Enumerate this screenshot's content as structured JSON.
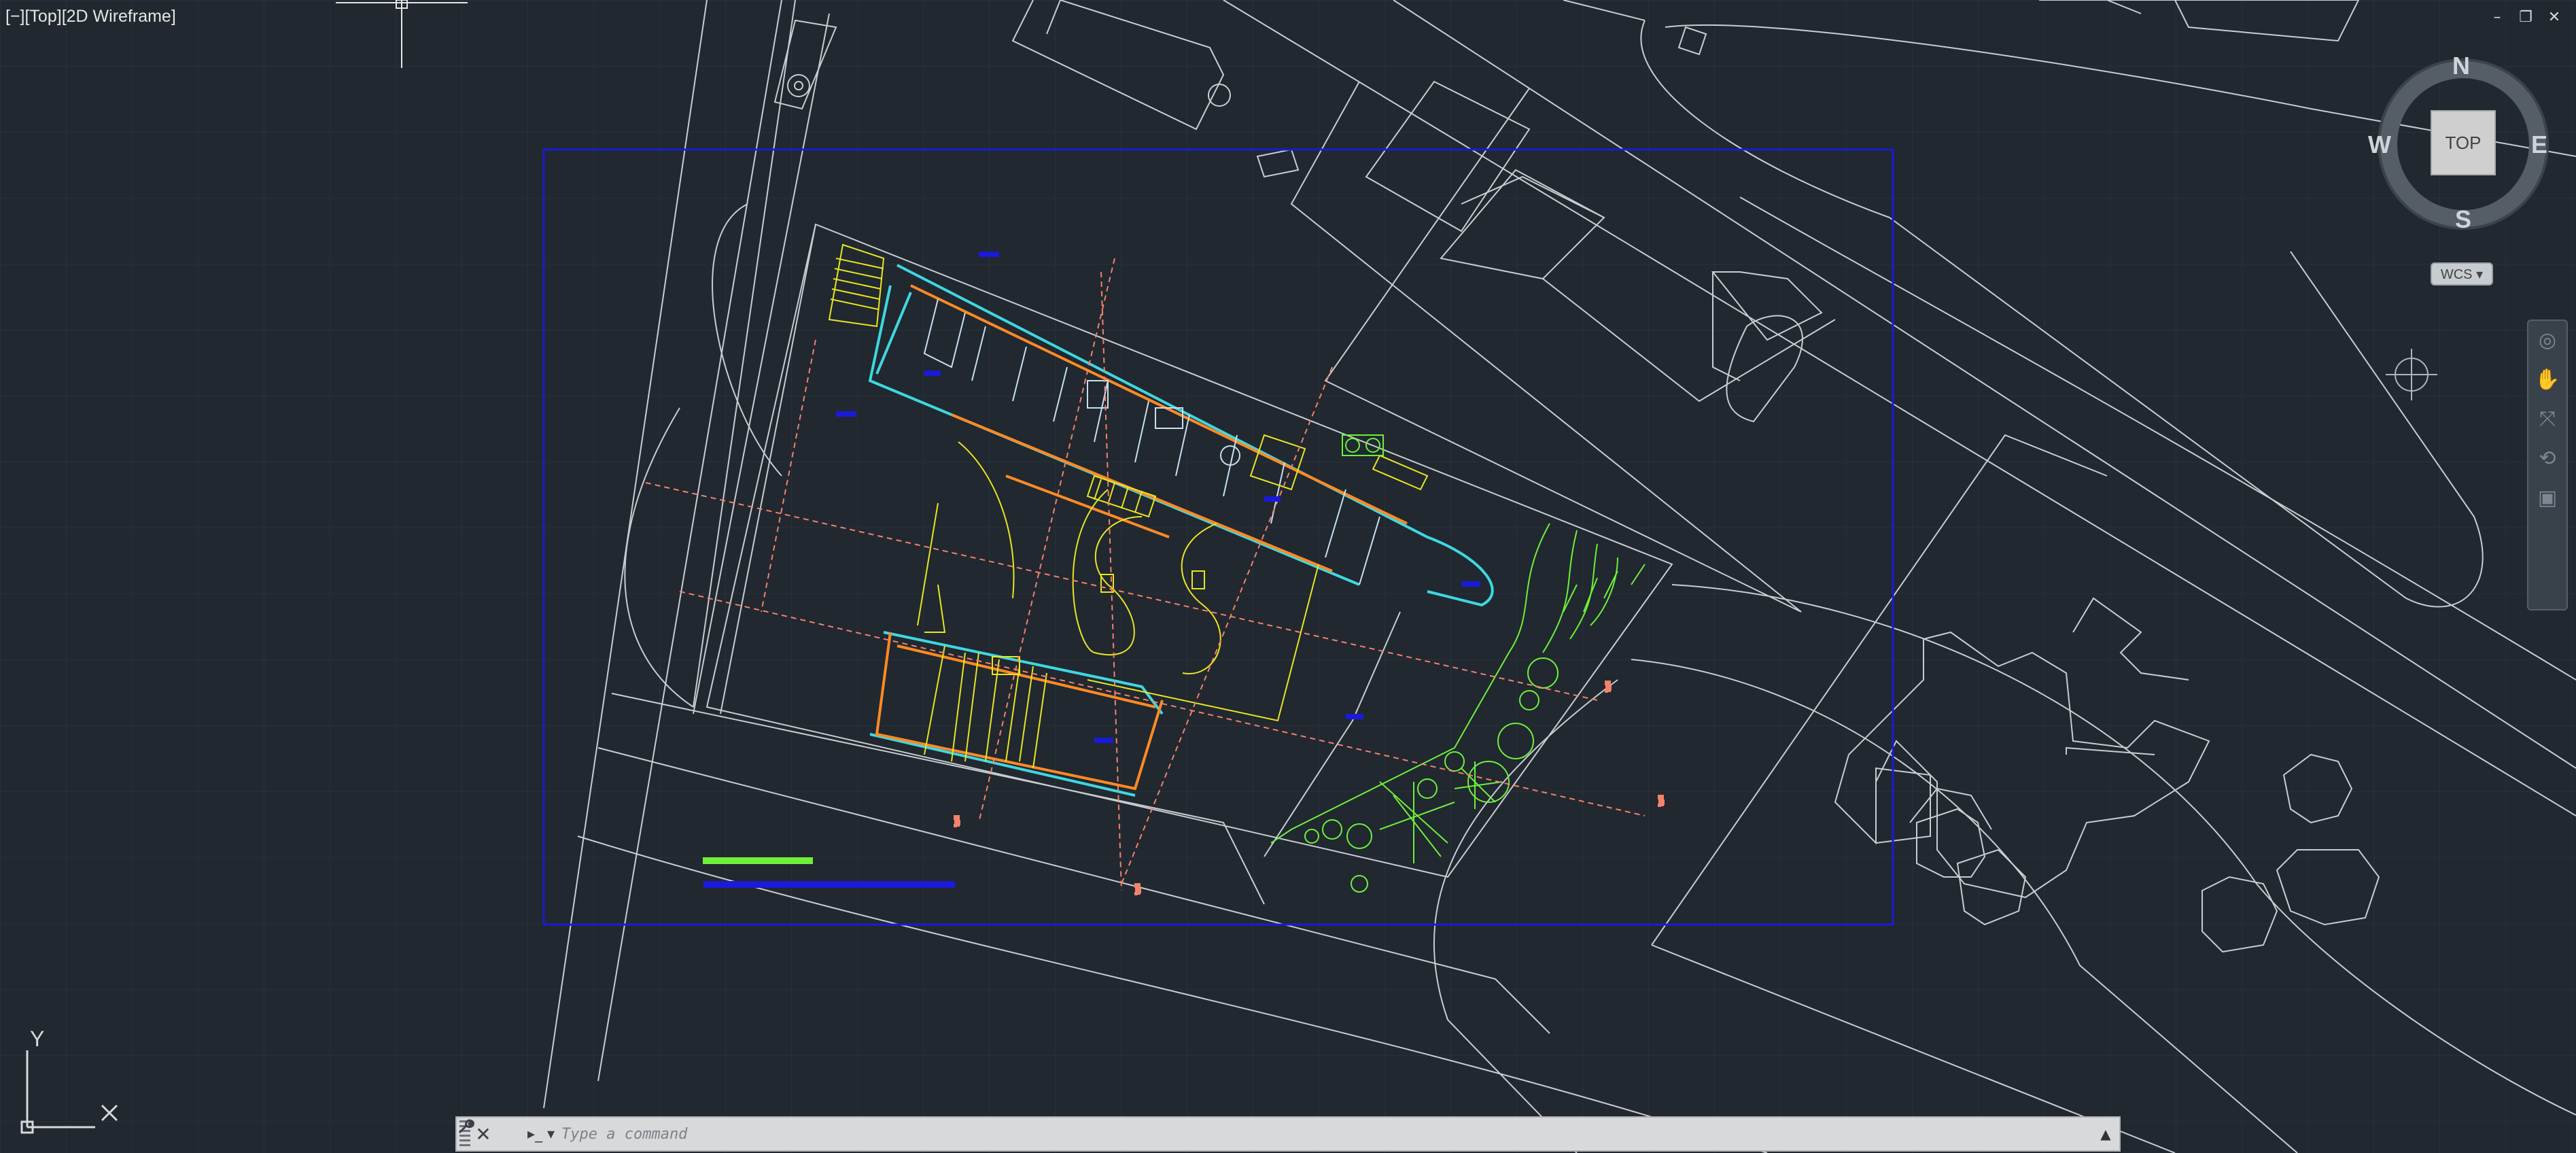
{
  "viewport": {
    "label": "[−][Top][2D Wireframe]"
  },
  "window_controls": {
    "minimize": "–",
    "restore": "❐",
    "close": "✕"
  },
  "viewcube": {
    "north": "N",
    "south": "S",
    "east": "E",
    "west": "W",
    "face": "TOP",
    "wcs_label": "WCS ▾"
  },
  "ucs": {
    "x_label": "X",
    "y_label": "Y"
  },
  "command_line": {
    "placeholder": "Type a command",
    "close_icon": "✕",
    "customize_icon": "wrench",
    "prompt_icon": "▸_ ▾",
    "expand_icon": "▲"
  },
  "navigation_bar": {
    "items": [
      "steering-wheel-icon",
      "pan-icon",
      "zoom-extents-icon",
      "orbit-icon",
      "showmotion-icon"
    ]
  },
  "colors": {
    "background": "#212830",
    "grid": "#2b323b",
    "line_white": "#c8cdd2",
    "layout_blue": "#1a1ad8",
    "cyan": "#3fd7e0",
    "orange": "#ff8a24",
    "yellow": "#e8e620",
    "green": "#6ef03a",
    "salmon": "#f2826a"
  }
}
